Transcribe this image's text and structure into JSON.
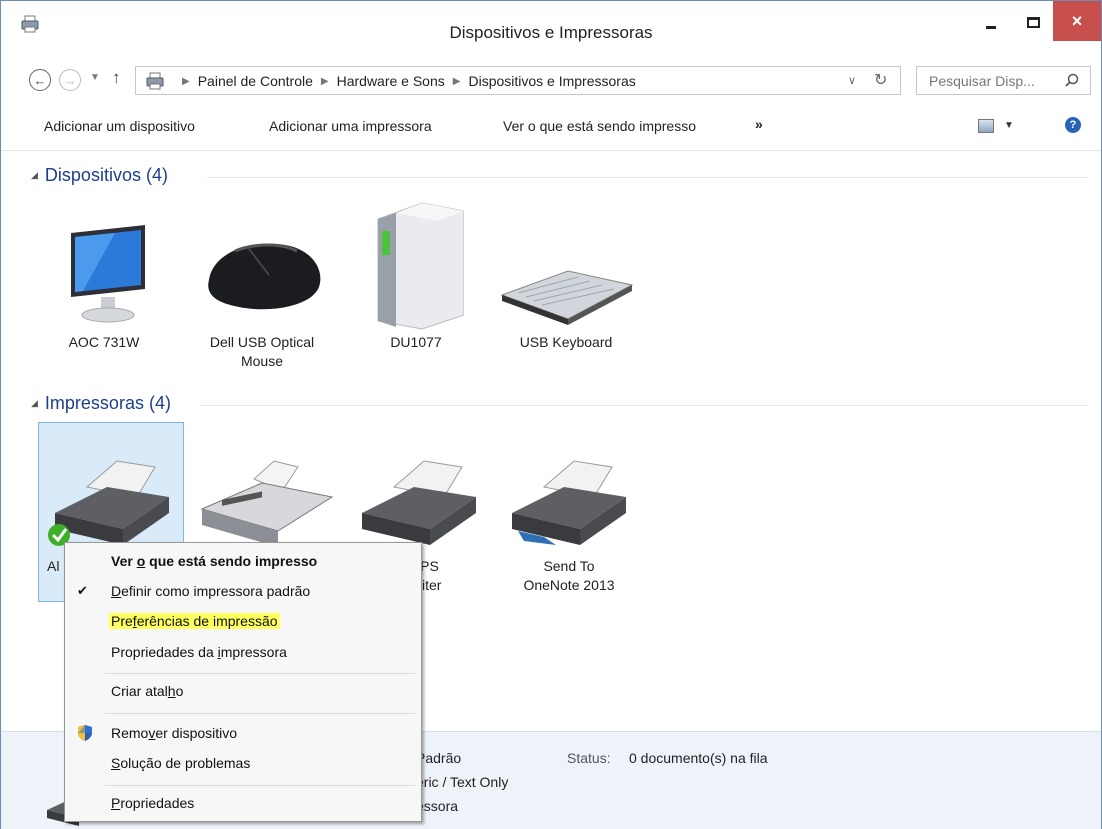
{
  "window": {
    "title": "Dispositivos e Impressoras",
    "close_glyph": "×"
  },
  "address": {
    "crumbs": [
      "Painel de Controle",
      "Hardware e Sons",
      "Dispositivos e Impressoras"
    ],
    "search_placeholder": "Pesquisar Disp..."
  },
  "toolbar": {
    "add_device": "Adicionar um dispositivo",
    "add_printer": "Adicionar uma impressora",
    "see_printing": "Ver o que está sendo impresso",
    "more": "»"
  },
  "devices": {
    "header": "Dispositivos (4)",
    "items": [
      {
        "label": "AOC 731W",
        "icon": "monitor-icon"
      },
      {
        "label": "Dell USB Optical Mouse",
        "icon": "mouse-icon"
      },
      {
        "label": "DU1077",
        "icon": "tower-pc-icon"
      },
      {
        "label": "USB Keyboard",
        "icon": "keyboard-icon"
      }
    ]
  },
  "printers": {
    "header": "Impressoras (4)",
    "items": [
      {
        "label_visible": "Al",
        "icon": "printer-default-icon"
      },
      {
        "label_visible": "",
        "icon": "fax-icon"
      },
      {
        "label_line1": "ft XPS",
        "label_line2": "t Writer",
        "icon": "printer-icon"
      },
      {
        "label_line1": "Send To",
        "label_line2": "OneNote 2013",
        "icon": "printer-onenote-icon"
      }
    ]
  },
  "details": {
    "line1_value": "Padrão",
    "status_key": "Status:",
    "status_value": "0 documento(s) na fila",
    "line2": "eric / Text Only",
    "line3": "essora"
  },
  "context_menu": {
    "items": [
      {
        "id": "see_printing",
        "pre": "Ver ",
        "accel": "o",
        "post": " que está sendo impresso",
        "bold": true
      },
      {
        "id": "set_default",
        "pre": "",
        "accel": "D",
        "post": "efinir como impressora padrão",
        "checked": true
      },
      {
        "id": "print_prefs",
        "pre": "Pre",
        "accel": "f",
        "post": "erências de impressão",
        "highlighted": true
      },
      {
        "id": "printer_props",
        "pre": "Propriedades da ",
        "accel": "i",
        "post": "mpressora"
      },
      {
        "id": "create_shortcut",
        "pre": "Criar atal",
        "accel": "h",
        "post": "o"
      },
      {
        "id": "remove_device",
        "pre": "Remo",
        "accel": "v",
        "post": "er dispositivo",
        "icon": "shield-icon"
      },
      {
        "id": "troubleshoot",
        "pre": "",
        "accel": "S",
        "post": "olução de problemas"
      },
      {
        "id": "properties",
        "pre": "",
        "accel": "P",
        "post": "ropriedades"
      }
    ],
    "check_glyph": "✔"
  },
  "colors": {
    "group_header": "#1e3f8a",
    "close_button": "#c7504c",
    "highlight": "#ffff60",
    "selection": "#d9ebf9"
  }
}
